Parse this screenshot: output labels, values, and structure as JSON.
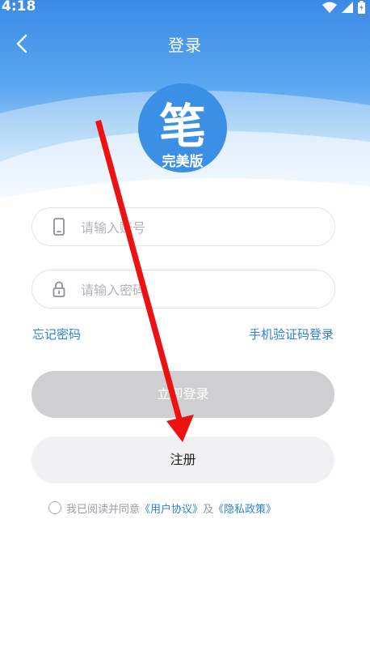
{
  "status_bar": {
    "time": "4:18"
  },
  "header": {
    "title": "登录"
  },
  "logo": {
    "main_char": "笔",
    "sub_text": "完美版"
  },
  "form": {
    "account_placeholder": "请输入账号",
    "password_placeholder": "请输入密码",
    "forgot_password": "忘记密码",
    "sms_login": "手机验证码登录",
    "login_button": "立即登录",
    "register_button": "注册"
  },
  "agreement": {
    "prefix": "我已阅读并同意",
    "user_agreement": "《用户协议》",
    "and": "及",
    "privacy_policy": "《隐私政策》"
  },
  "colors": {
    "header_blue": "#3b8be6",
    "link_blue": "#2e80d8",
    "disabled_button": "#cfcfd1",
    "arrow_red": "#ee1111"
  },
  "icons": [
    "back-arrow-icon",
    "wifi-icon",
    "signal-icon",
    "battery-icon",
    "phone-icon",
    "lock-icon"
  ]
}
